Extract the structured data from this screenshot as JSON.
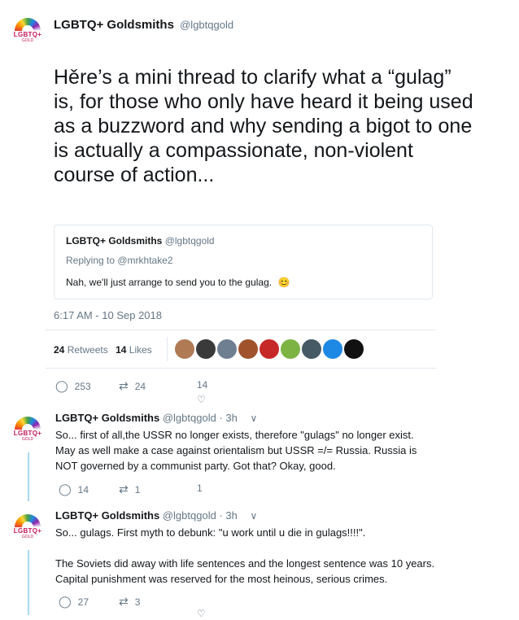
{
  "account": {
    "name": "LGBTQ+ Goldsmiths",
    "handle": "@lgbtqgold",
    "avatar_text": "LGBTQ+",
    "avatar_subtext": "GOLD"
  },
  "main_tweet": {
    "text": "Hěre’s a mini thread to clarify what a “gulag” is, for those who only have heard it being used as a buzzword and why sending a bigot to one is actually a compassionate, non-violent course of action...",
    "timestamp": "6:17 AM - 10 Sep 2018",
    "retweets_count": "24",
    "retweets_label": "Retweets",
    "likes_count": "14",
    "likes_label": "Likes",
    "replies": "253",
    "retweets": "24",
    "likes": "14"
  },
  "quoted_tweet": {
    "name": "LGBTQ+ Goldsmiths",
    "handle": "@lgbtqgold",
    "replying_to": "Replying to @mrkhtake2",
    "text": "Nah, we'll just arrange to send you to the gulag.",
    "emoji": "😊"
  },
  "likers": [
    {
      "name": "liker-1",
      "color": "#b07a55"
    },
    {
      "name": "liker-2",
      "color": "#3a3a3a"
    },
    {
      "name": "liker-3",
      "color": "#6d7f91"
    },
    {
      "name": "liker-4",
      "color": "#a0522d"
    },
    {
      "name": "liker-5",
      "color": "#c62828"
    },
    {
      "name": "liker-6",
      "color": "#7cb342"
    },
    {
      "name": "liker-7",
      "color": "#455a64"
    },
    {
      "name": "liker-8",
      "color": "#1e88e5"
    },
    {
      "name": "liker-9",
      "color": "#111111"
    }
  ],
  "replies": [
    {
      "name": "LGBTQ+ Goldsmiths",
      "handle": "@lgbtqgold",
      "time": "· 3h",
      "lines": [
        "So... first of all,the USSR no longer exists, therefore \"gulags\" no longer exist.",
        "May as well make a case against orientalism but USSR =/= Russia. Russia is",
        "NOT governed by a communist party. Got that? Okay, good."
      ],
      "replies": "14",
      "retweets": "1",
      "likes": "1"
    },
    {
      "name": "LGBTQ+ Goldsmiths",
      "handle": "@lgbtqgold",
      "time": "· 3h",
      "lines": [
        "So... gulags. First myth to debunk: \"u work until u die in gulags!!!!\".",
        "",
        "The Soviets did away with life sentences and the longest sentence was 10 years.",
        "Capital punishment was reserved for the most heinous, serious crimes."
      ],
      "replies": "27",
      "retweets": "3",
      "likes": ""
    }
  ],
  "colors": {
    "text": "#14171a",
    "muted": "#657786",
    "border": "#e1e8ed",
    "thread_line": "#a9d8f2",
    "brand": "#c2185b"
  }
}
